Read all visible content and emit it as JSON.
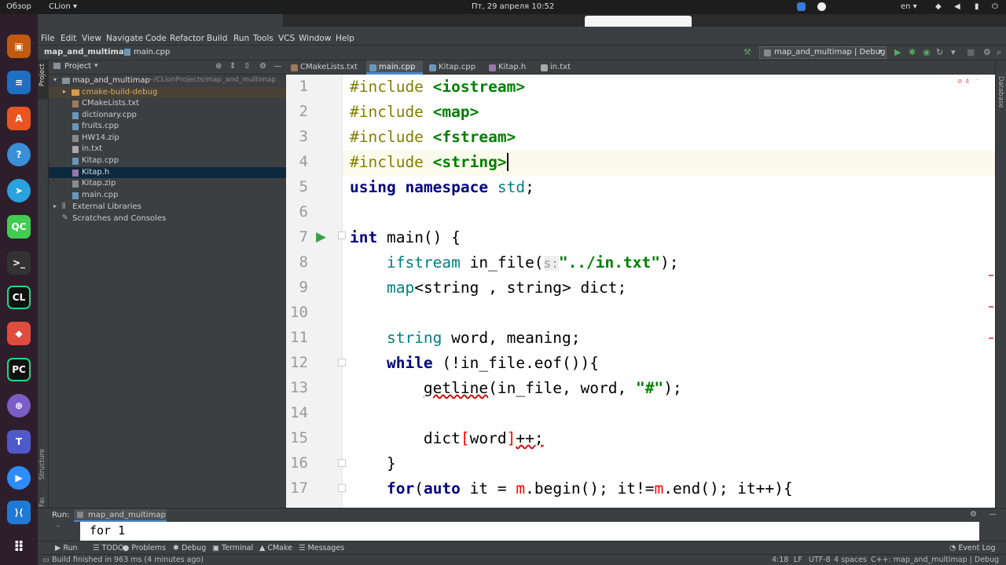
{
  "system_bar": {
    "overview": "Обзор",
    "app_menu": "CLion ▾",
    "clock": "Пт, 29 апреля  10:52",
    "language": "en ▾"
  },
  "menu": [
    "File",
    "Edit",
    "View",
    "Navigate",
    "Code",
    "Refactor",
    "Build",
    "Run",
    "Tools",
    "VCS",
    "Window",
    "Help"
  ],
  "breadcrumbs": {
    "project": "map_and_multimap",
    "file": "main.cpp"
  },
  "run_config": "map_and_multimap | Debug",
  "project_panel": {
    "title": "Project",
    "items": [
      {
        "label": "map_and_multimap",
        "path": "~/CLionProjects/map_and_multimap",
        "kind": "root"
      },
      {
        "label": "cmake-build-debug",
        "kind": "folder"
      },
      {
        "label": "CMakeLists.txt",
        "kind": "file"
      },
      {
        "label": "dictionary.cpp",
        "kind": "file"
      },
      {
        "label": "fruits.cpp",
        "kind": "file"
      },
      {
        "label": "HW14.zip",
        "kind": "file"
      },
      {
        "label": "in.txt",
        "kind": "file"
      },
      {
        "label": "Kitap.cpp",
        "kind": "file"
      },
      {
        "label": "Kitap.h",
        "kind": "file"
      },
      {
        "label": "Kitap.zip",
        "kind": "file"
      },
      {
        "label": "main.cpp",
        "kind": "file"
      },
      {
        "label": "External Libraries",
        "kind": "group"
      },
      {
        "label": "Scratches and Consoles",
        "kind": "group"
      }
    ]
  },
  "tabs": [
    "CMakeLists.txt",
    "main.cpp",
    "Kitap.cpp",
    "Kitap.h",
    "in.txt"
  ],
  "active_tab": "main.cpp",
  "side_labels": {
    "project": "Project",
    "structure": "Structure",
    "favorites": "Favorites",
    "database": "Database"
  },
  "error_badge": "4",
  "line_numbers": [
    "1",
    "2",
    "3",
    "4",
    "5",
    "6",
    "7",
    "8",
    "9",
    "10",
    "11",
    "12",
    "13",
    "14",
    "15",
    "16",
    "17"
  ],
  "code": {
    "l1": [
      "#include ",
      "<iostream>"
    ],
    "l2": [
      "#include ",
      "<map>"
    ],
    "l3": [
      "#include ",
      "<fstream>"
    ],
    "l4": [
      "#include ",
      "<string>"
    ],
    "l5": [
      "using namespace ",
      "std",
      ";"
    ],
    "l7": [
      "int",
      " main() {"
    ],
    "l8": [
      "    ",
      "ifstream",
      " in_file(",
      "s:",
      "\"../in.txt\"",
      ");"
    ],
    "l9": [
      "    ",
      "map",
      "<string , string> dict;"
    ],
    "l11": [
      "    ",
      "string",
      " word, meaning;"
    ],
    "l12": [
      "    ",
      "while",
      " (!in_file.eof()){"
    ],
    "l13": [
      "        ",
      "getline",
      "(in_file, word, ",
      "\"#\"",
      ");"
    ],
    "l15": [
      "        dict",
      "[",
      "word",
      "]",
      "++;"
    ],
    "l16": [
      "    }"
    ],
    "l17": [
      "    ",
      "for",
      "(",
      "auto",
      " it = ",
      "m",
      ".begin(); it!=",
      "m",
      ".end(); it++){"
    ]
  },
  "run_panel": {
    "label": "Run:",
    "config": "map_and_multimap",
    "output": "for 1"
  },
  "bottom_tools": [
    "Run",
    "TODO",
    "Problems",
    "Debug",
    "Terminal",
    "CMake",
    "Messages"
  ],
  "event_log": "Event Log",
  "status": {
    "message": "Build finished in 963 ms (4 minutes ago)",
    "position": "4:18",
    "line_sep": "LF",
    "encoding": "UTF-8",
    "indent": "4 spaces",
    "context": "C++: map_and_multimap | Debug"
  }
}
